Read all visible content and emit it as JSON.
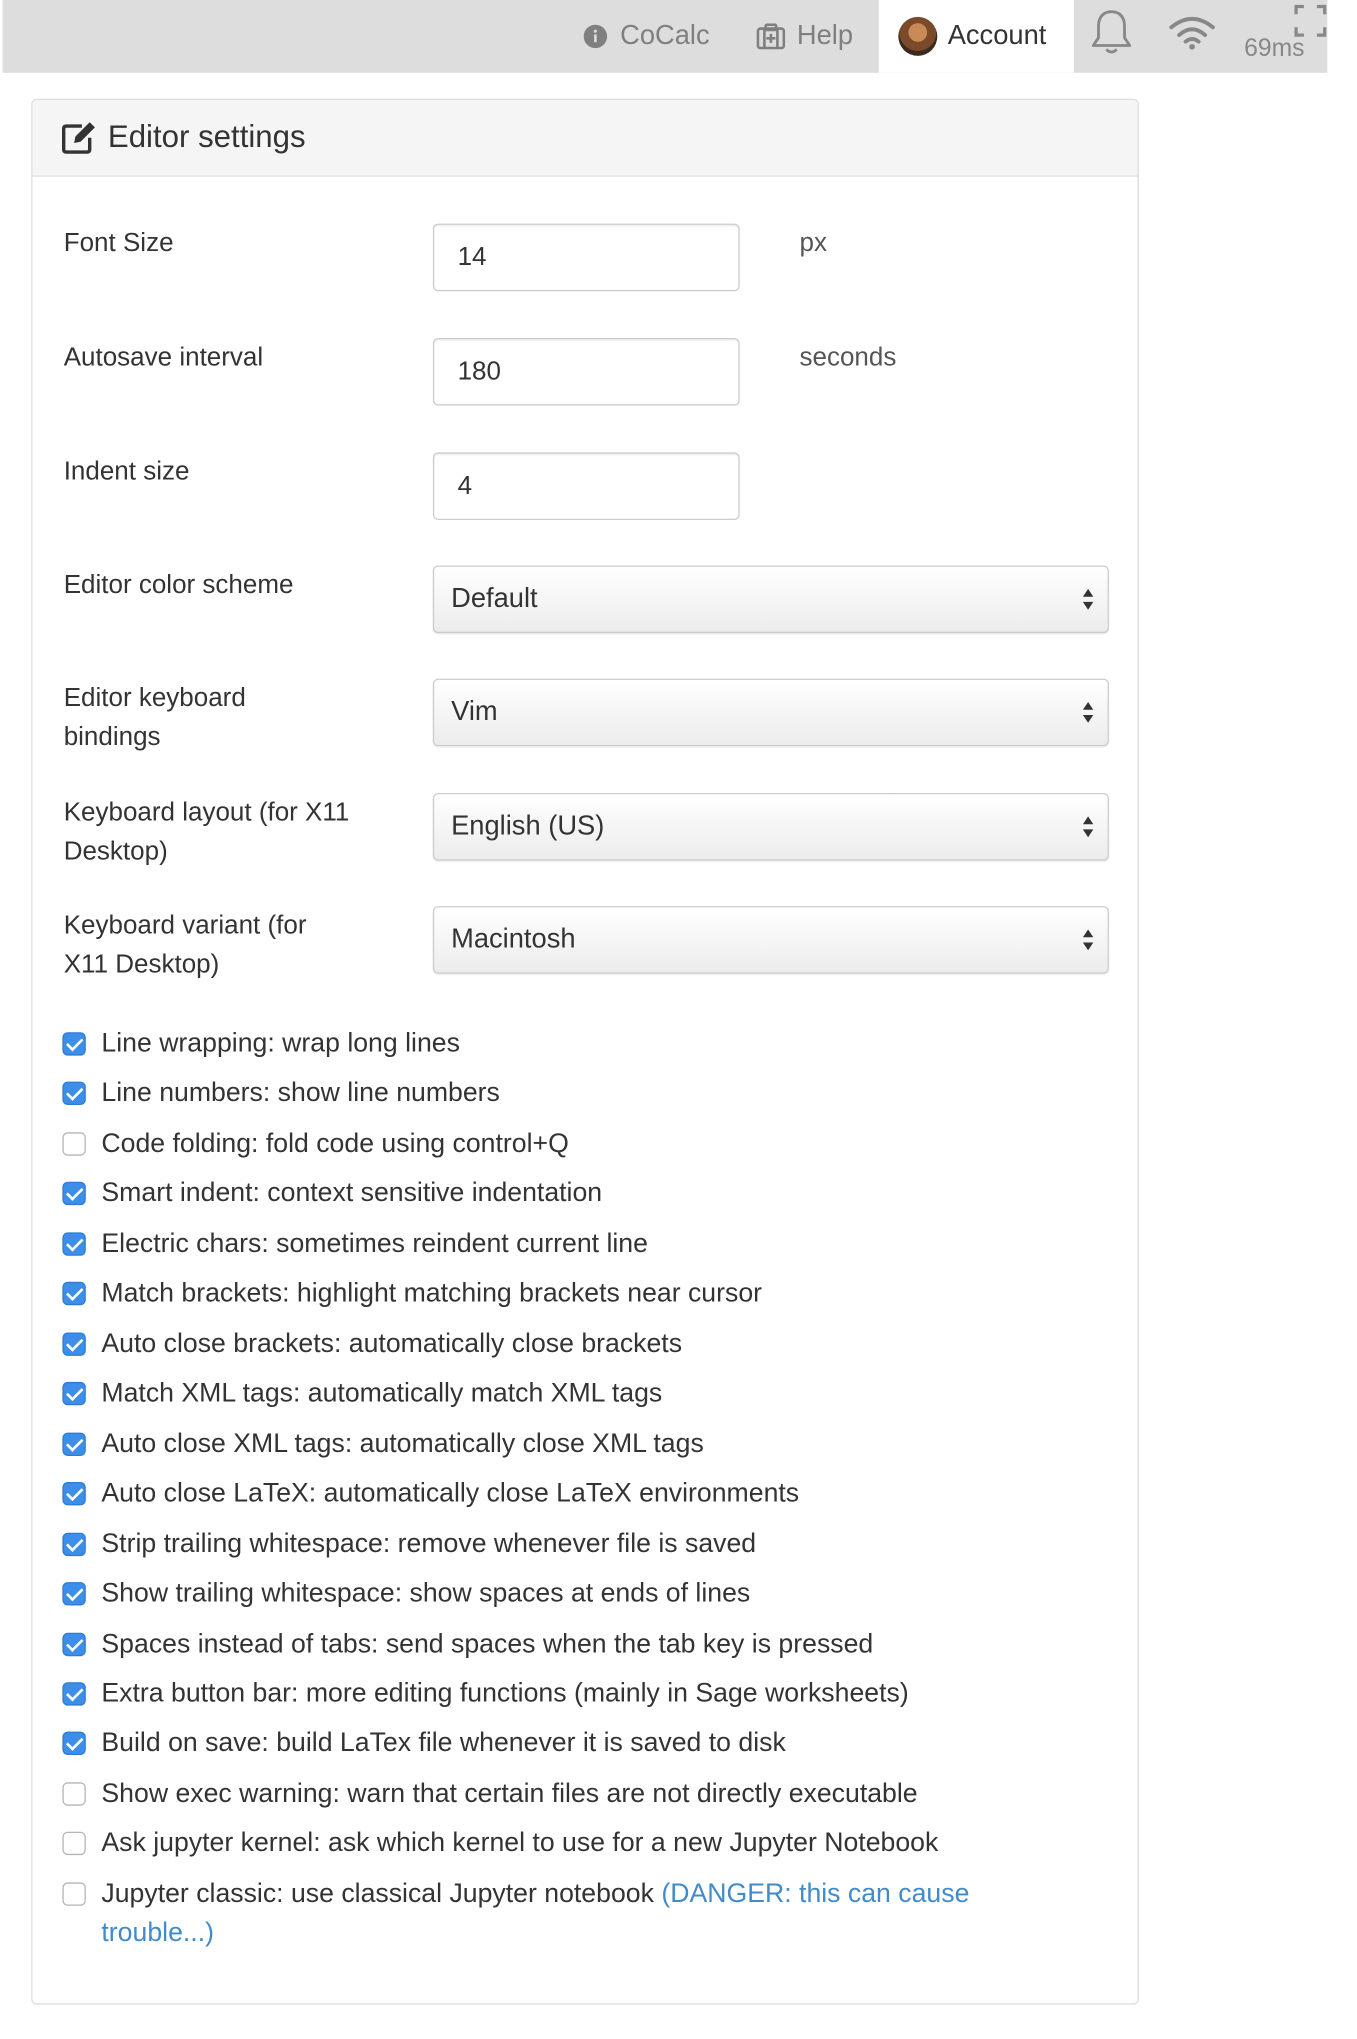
{
  "topbar": {
    "cocalc_label": "CoCalc",
    "help_label": "Help",
    "account_label": "Account",
    "ping": "69ms"
  },
  "panel": {
    "title": "Editor settings"
  },
  "fields": {
    "font_size": {
      "label": "Font Size",
      "value": "14",
      "unit": "px"
    },
    "autosave": {
      "label": "Autosave interval",
      "value": "180",
      "unit": "seconds"
    },
    "indent": {
      "label": "Indent size",
      "value": "4"
    },
    "color_scheme": {
      "label": "Editor color scheme",
      "value": "Default"
    },
    "keybindings": {
      "label": "Editor keyboard bindings",
      "value": "Vim"
    },
    "kb_layout": {
      "label": "Keyboard layout (for X11 Desktop)",
      "value": "English (US)"
    },
    "kb_variant": {
      "label": "Keyboard variant (for X11 Desktop)",
      "value": "Macintosh"
    }
  },
  "options": [
    {
      "label": "Line wrapping: wrap long lines",
      "checked": true
    },
    {
      "label": "Line numbers: show line numbers",
      "checked": true
    },
    {
      "label": "Code folding: fold code using control+Q",
      "checked": false
    },
    {
      "label": "Smart indent: context sensitive indentation",
      "checked": true
    },
    {
      "label": "Electric chars: sometimes reindent current line",
      "checked": true
    },
    {
      "label": "Match brackets: highlight matching brackets near cursor",
      "checked": true
    },
    {
      "label": "Auto close brackets: automatically close brackets",
      "checked": true
    },
    {
      "label": "Match XML tags: automatically match XML tags",
      "checked": true
    },
    {
      "label": "Auto close XML tags: automatically close XML tags",
      "checked": true
    },
    {
      "label": "Auto close LaTeX: automatically close LaTeX environments",
      "checked": true
    },
    {
      "label": "Strip trailing whitespace: remove whenever file is saved",
      "checked": true
    },
    {
      "label": "Show trailing whitespace: show spaces at ends of lines",
      "checked": true
    },
    {
      "label": "Spaces instead of tabs: send spaces when the tab key is pressed",
      "checked": true
    },
    {
      "label": "Extra button bar: more editing functions (mainly in Sage worksheets)",
      "checked": true
    },
    {
      "label": "Build on save: build LaTex file whenever it is saved to disk",
      "checked": true
    },
    {
      "label": "Show exec warning: warn that certain files are not directly executable",
      "checked": false
    },
    {
      "label": "Ask jupyter kernel: ask which kernel to use for a new Jupyter Notebook",
      "checked": false
    },
    {
      "label": "Jupyter classic: use classical Jupyter notebook",
      "checked": false,
      "danger": "(DANGER: this can cause trouble...)"
    }
  ],
  "colors": {
    "checkbox_on": "#3d8ee8",
    "link": "#428bca",
    "topbar_bg": "#dddddd"
  }
}
